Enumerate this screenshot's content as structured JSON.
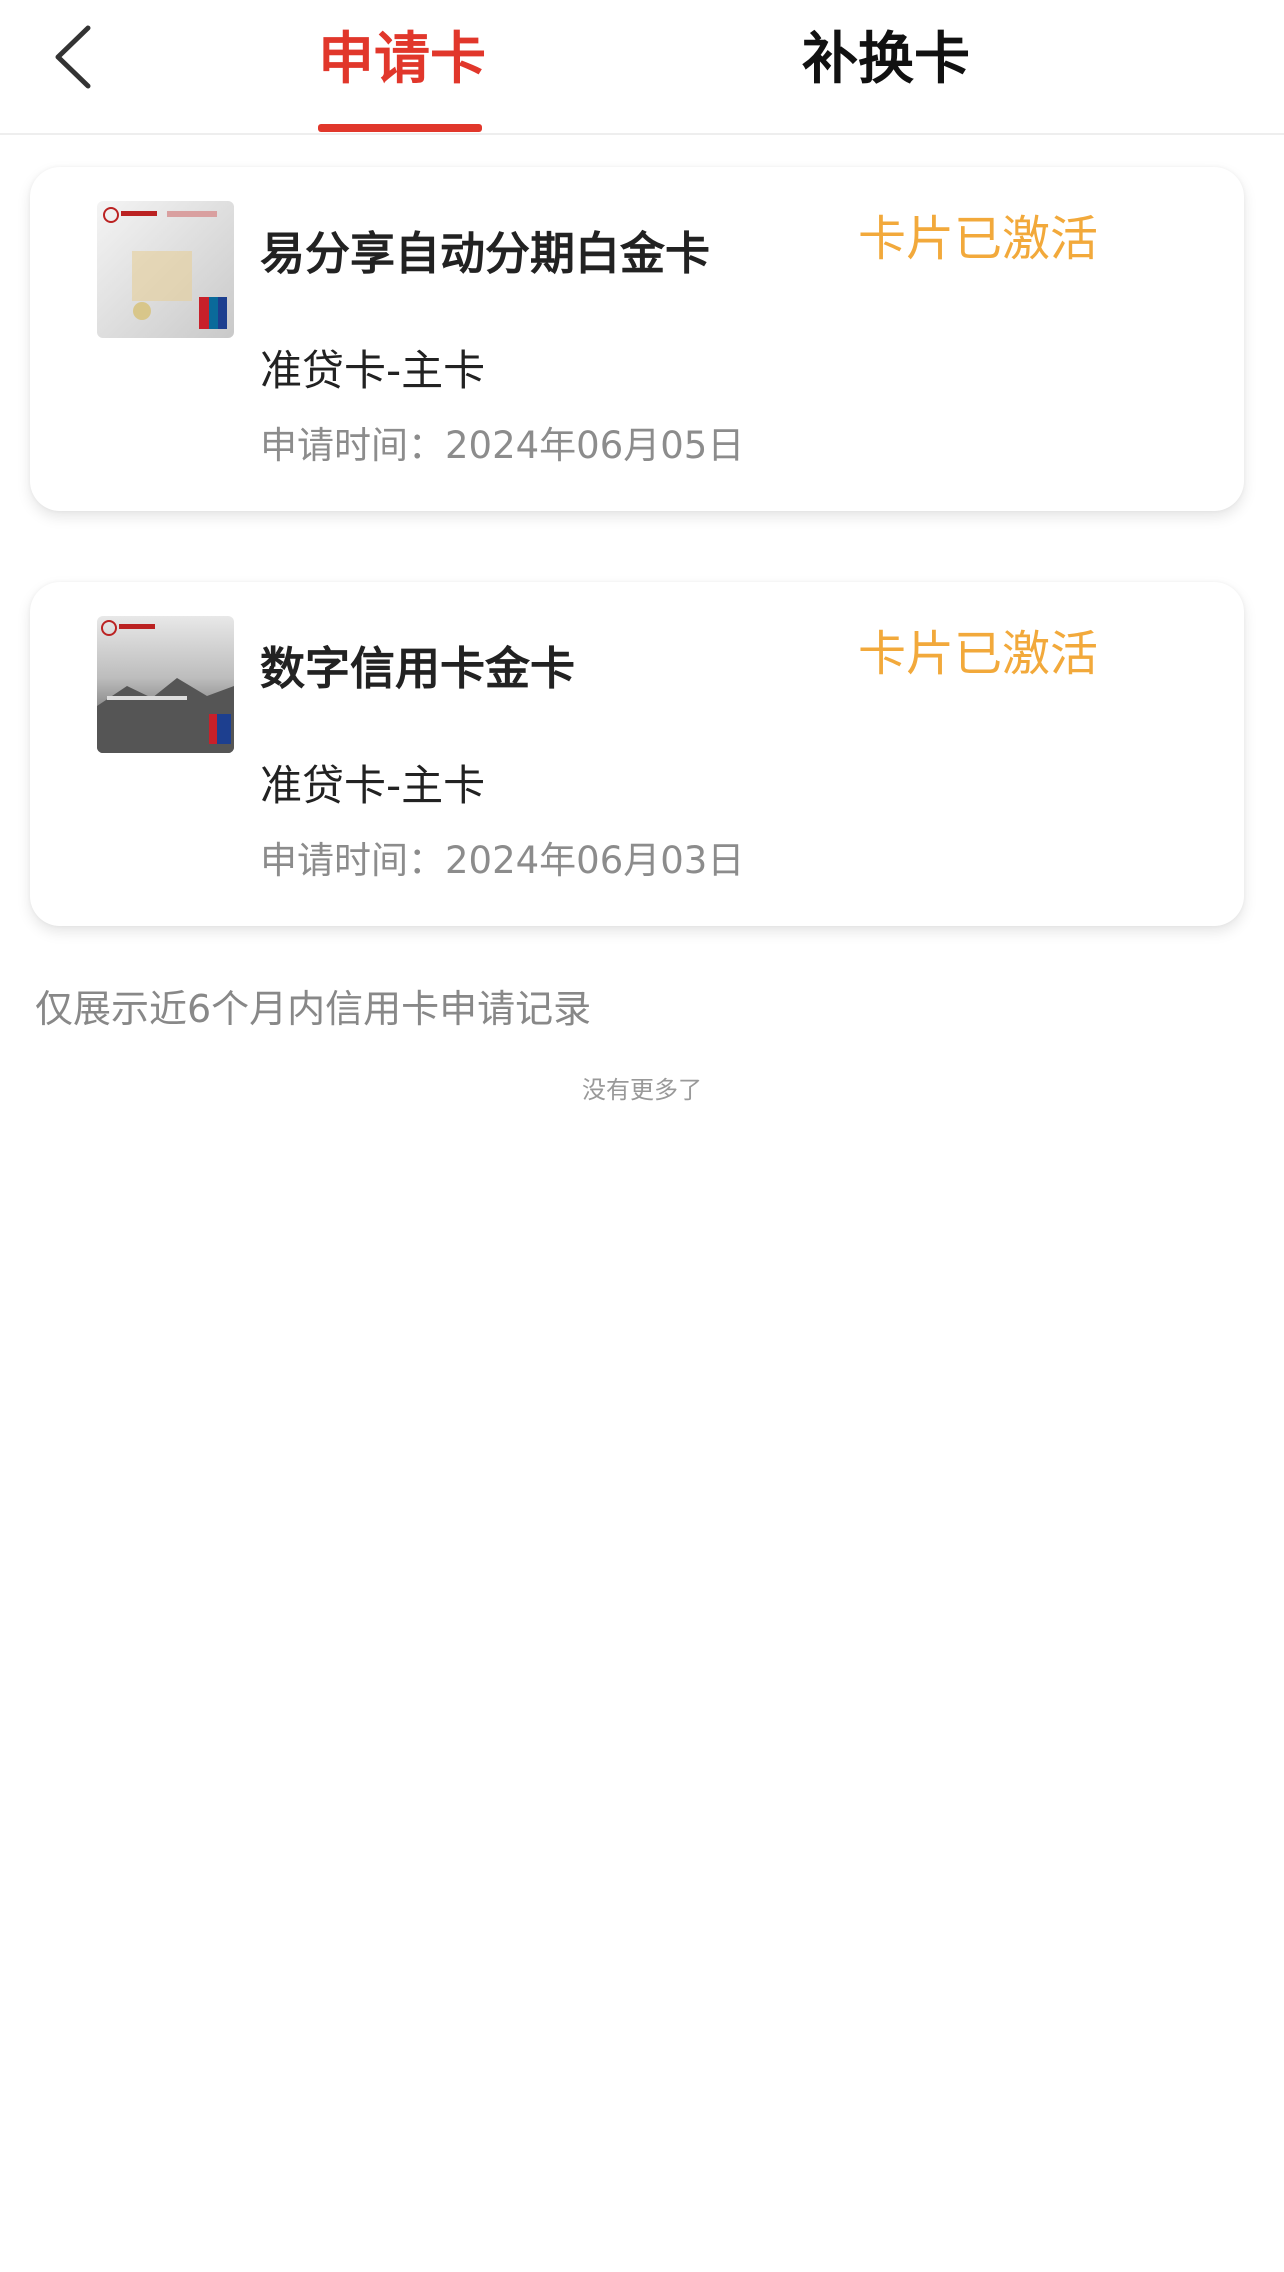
{
  "header": {
    "tabs": [
      {
        "label": "申请卡",
        "active": true
      },
      {
        "label": "补换卡",
        "active": false
      }
    ],
    "accent_color": "#e1372b"
  },
  "cards": [
    {
      "name": "易分享自动分期白金卡",
      "status": "卡片已激活",
      "type": "准贷卡-主卡",
      "date_label": "申请时间：2024年06月05日",
      "thumbnail": "silver-card-image"
    },
    {
      "name": "数字信用卡金卡",
      "status": "卡片已激活",
      "type": "准贷卡-主卡",
      "date_label": "申请时间：2024年06月03日",
      "thumbnail": "gray-card-image"
    }
  ],
  "status_color": "#f2a93b",
  "footer": {
    "note": "仅展示近6个月内信用卡申请记录",
    "no_more": "没有更多了"
  }
}
